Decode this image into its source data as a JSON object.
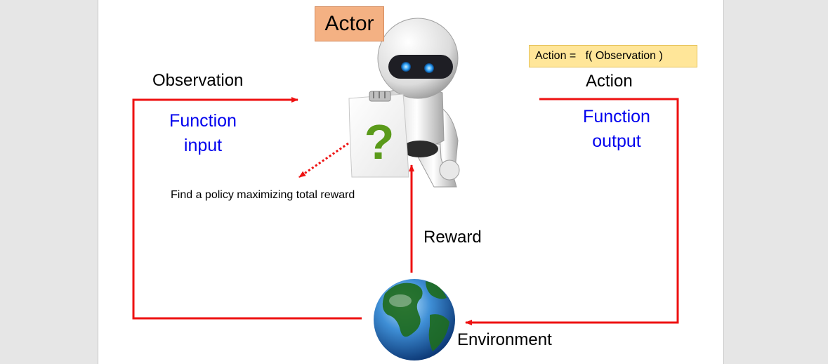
{
  "diagram": {
    "actor_label": "Actor",
    "formula": "Action =   f( Observation )",
    "observation_label": "Observation",
    "function_input_line1": "Function",
    "function_input_line2": "input",
    "action_label": "Action",
    "function_output_line1": "Function",
    "function_output_line2": "output",
    "policy_note": "Find a policy maximizing total reward",
    "reward_label": "Reward",
    "environment_label": "Environment",
    "question_mark": "?"
  },
  "colors": {
    "arrow": "#ee1111",
    "function_text": "#0000ee",
    "actor_box": "#f4b183",
    "formula_box": "#ffe699",
    "question_mark": "#5a9a1a"
  },
  "icons": [
    "robot-icon",
    "globe-icon",
    "question-sign-icon"
  ]
}
